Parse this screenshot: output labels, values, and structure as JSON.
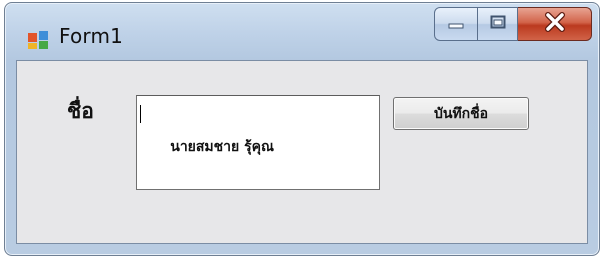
{
  "window": {
    "title": "Form1",
    "app_icon": "form-icon",
    "caption_buttons": {
      "minimize_icon": "minimize-icon",
      "maximize_icon": "maximize-icon",
      "close_icon": "close-icon"
    }
  },
  "form": {
    "name_label": "ชื่อ",
    "name_textbox": {
      "value": "นายสมชาย รุ้คุณ"
    },
    "save_button": {
      "label": "บันทึกชื่อ"
    }
  },
  "colors": {
    "frame_light": "#cfdff0",
    "frame_dark": "#b3c8e0",
    "client_background": "#e7e7e9",
    "close_button_red": "#c7462b",
    "textbox_background": "#ffffff"
  }
}
